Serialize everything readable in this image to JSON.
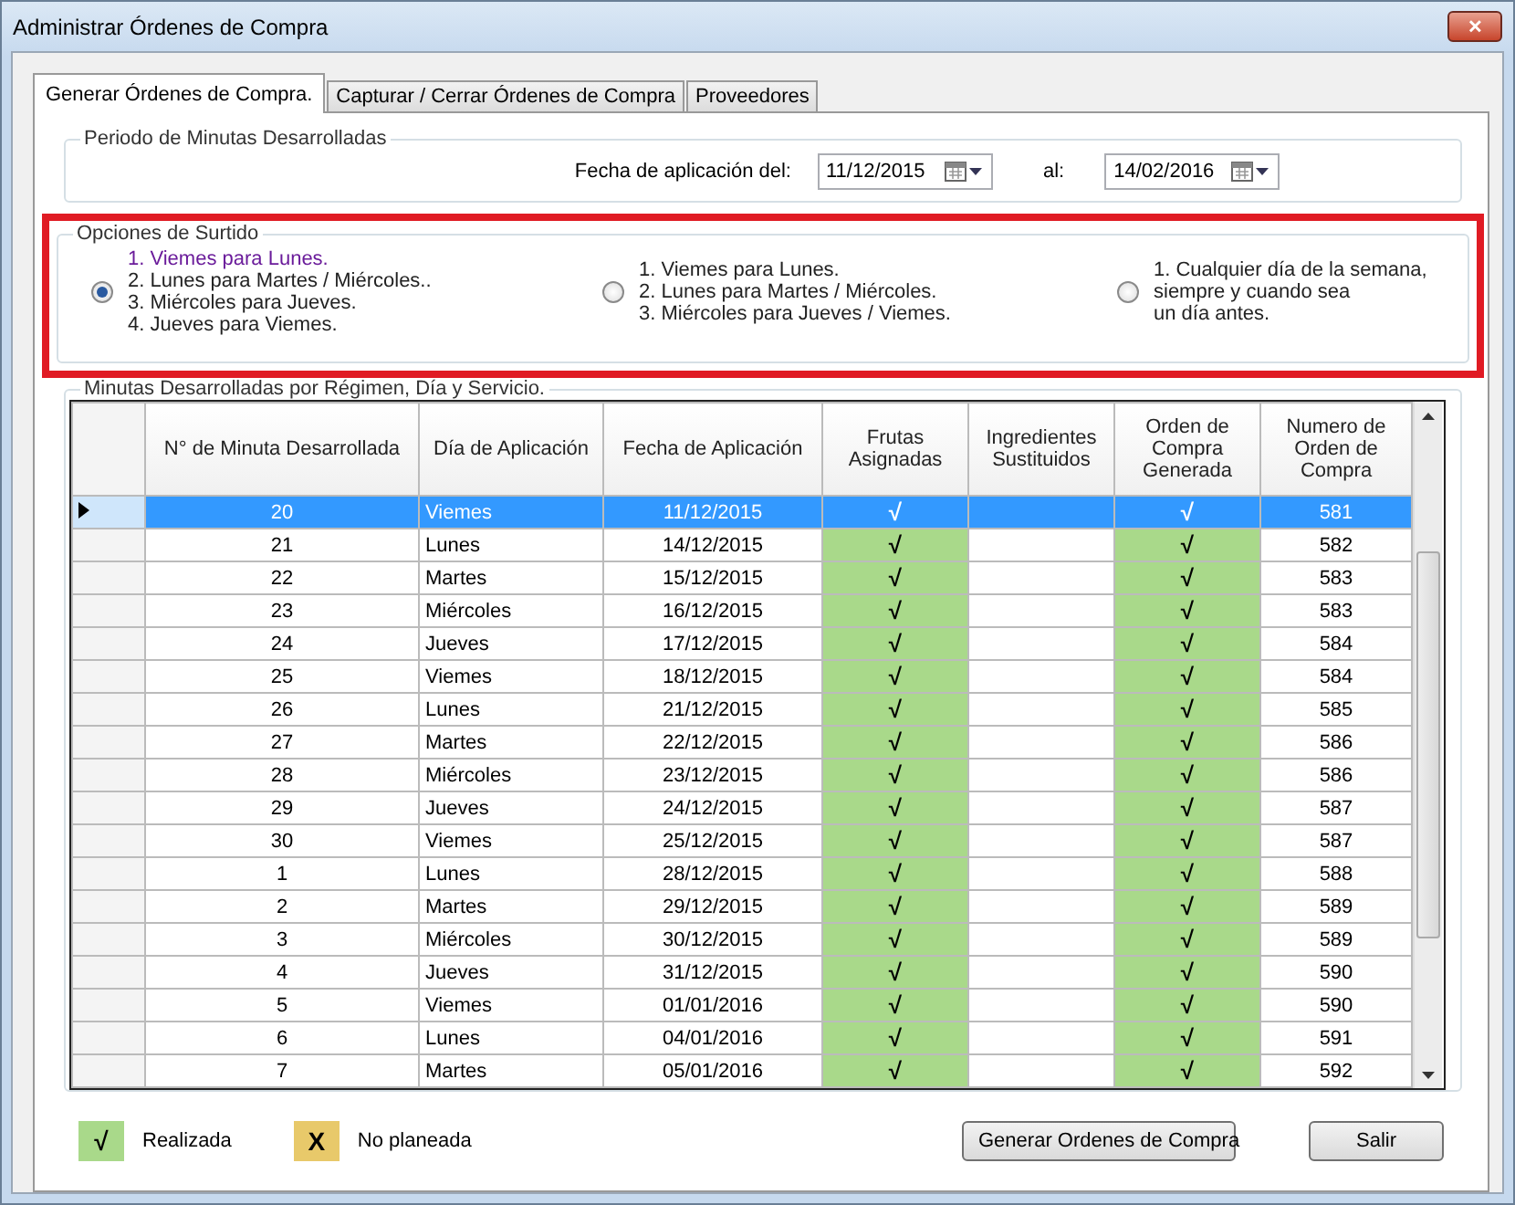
{
  "window": {
    "title": "Administrar Órdenes de Compra",
    "close": "✕"
  },
  "tabs": [
    {
      "label": "Generar Órdenes de Compra.",
      "selected": true
    },
    {
      "label": "Capturar / Cerrar Órdenes de Compra",
      "selected": false
    },
    {
      "label": "Proveedores",
      "selected": false
    }
  ],
  "periodo": {
    "title": "Periodo de Minutas Desarrolladas",
    "from_label": "Fecha de aplicación del:",
    "from_value": "11/12/2015",
    "to_label": "al:",
    "to_value": "14/02/2016"
  },
  "opciones": {
    "title": "Opciones de Surtido",
    "options": [
      {
        "lines": [
          "1. Viemes para Lunes.",
          "2. Lunes para Martes / Miércoles..",
          "3. Miércoles para Jueves.",
          "4. Jueves para Viemes."
        ],
        "selected": true
      },
      {
        "lines": [
          "1. Viemes para Lunes.",
          "2. Lunes para Martes / Miércoles.",
          "3. Miércoles para Jueves / Viemes."
        ],
        "selected": false
      },
      {
        "lines": [
          "1. Cualquier día de la semana,",
          "siempre y cuando sea",
          "un día antes."
        ],
        "selected": false
      }
    ]
  },
  "table": {
    "title": "Minutas Desarrolladas por Régimen, Día y Servicio.",
    "columns": [
      "N° de Minuta Desarrollada",
      "Día de Aplicación",
      "Fecha de Aplicación",
      "Frutas Asignadas",
      "Ingredientes Sustituidos",
      "Orden de Compra Generada",
      "Numero de Orden de Compra"
    ],
    "rows": [
      {
        "minuta": "20",
        "dia": "Viemes",
        "fecha": "11/12/2015",
        "frutas": "√",
        "frutas_done": true,
        "orden": "√",
        "orden_done": true,
        "numero": "581",
        "selected": true
      },
      {
        "minuta": "21",
        "dia": "Lunes",
        "fecha": "14/12/2015",
        "frutas": "√",
        "frutas_done": true,
        "orden": "√",
        "orden_done": true,
        "numero": "582",
        "selected": false
      },
      {
        "minuta": "22",
        "dia": "Martes",
        "fecha": "15/12/2015",
        "frutas": "√",
        "frutas_done": true,
        "orden": "√",
        "orden_done": true,
        "numero": "583",
        "selected": false
      },
      {
        "minuta": "23",
        "dia": "Miércoles",
        "fecha": "16/12/2015",
        "frutas": "√",
        "frutas_done": true,
        "orden": "√",
        "orden_done": true,
        "numero": "583",
        "selected": false
      },
      {
        "minuta": "24",
        "dia": "Jueves",
        "fecha": "17/12/2015",
        "frutas": "√",
        "frutas_done": true,
        "orden": "√",
        "orden_done": true,
        "numero": "584",
        "selected": false
      },
      {
        "minuta": "25",
        "dia": "Viemes",
        "fecha": "18/12/2015",
        "frutas": "√",
        "frutas_done": true,
        "orden": "√",
        "orden_done": true,
        "numero": "584",
        "selected": false
      },
      {
        "minuta": "26",
        "dia": "Lunes",
        "fecha": "21/12/2015",
        "frutas": "√",
        "frutas_done": true,
        "orden": "√",
        "orden_done": true,
        "numero": "585",
        "selected": false
      },
      {
        "minuta": "27",
        "dia": "Martes",
        "fecha": "22/12/2015",
        "frutas": "√",
        "frutas_done": true,
        "orden": "√",
        "orden_done": true,
        "numero": "586",
        "selected": false
      },
      {
        "minuta": "28",
        "dia": "Miércoles",
        "fecha": "23/12/2015",
        "frutas": "√",
        "frutas_done": true,
        "orden": "√",
        "orden_done": true,
        "numero": "586",
        "selected": false
      },
      {
        "minuta": "29",
        "dia": "Jueves",
        "fecha": "24/12/2015",
        "frutas": "√",
        "frutas_done": true,
        "orden": "√",
        "orden_done": true,
        "numero": "587",
        "selected": false
      },
      {
        "minuta": "30",
        "dia": "Viemes",
        "fecha": "25/12/2015",
        "frutas": "√",
        "frutas_done": true,
        "orden": "√",
        "orden_done": true,
        "numero": "587",
        "selected": false
      },
      {
        "minuta": "1",
        "dia": "Lunes",
        "fecha": "28/12/2015",
        "frutas": "√",
        "frutas_done": true,
        "orden": "√",
        "orden_done": true,
        "numero": "588",
        "selected": false
      },
      {
        "minuta": "2",
        "dia": "Martes",
        "fecha": "29/12/2015",
        "frutas": "√",
        "frutas_done": true,
        "orden": "√",
        "orden_done": true,
        "numero": "589",
        "selected": false
      },
      {
        "minuta": "3",
        "dia": "Miércoles",
        "fecha": "30/12/2015",
        "frutas": "√",
        "frutas_done": true,
        "orden": "√",
        "orden_done": true,
        "numero": "589",
        "selected": false
      },
      {
        "minuta": "4",
        "dia": "Jueves",
        "fecha": "31/12/2015",
        "frutas": "√",
        "frutas_done": true,
        "orden": "√",
        "orden_done": true,
        "numero": "590",
        "selected": false
      },
      {
        "minuta": "5",
        "dia": "Viemes",
        "fecha": "01/01/2016",
        "frutas": "√",
        "frutas_done": true,
        "orden": "√",
        "orden_done": true,
        "numero": "590",
        "selected": false
      },
      {
        "minuta": "6",
        "dia": "Lunes",
        "fecha": "04/01/2016",
        "frutas": "√",
        "frutas_done": true,
        "orden": "√",
        "orden_done": true,
        "numero": "591",
        "selected": false
      },
      {
        "minuta": "7",
        "dia": "Martes",
        "fecha": "05/01/2016",
        "frutas": "√",
        "frutas_done": true,
        "orden": "√",
        "orden_done": true,
        "numero": "592",
        "selected": false
      }
    ]
  },
  "legend": [
    {
      "symbol": "√",
      "label": "Realizada",
      "color": "#a9d98a"
    },
    {
      "symbol": "X",
      "label": "No planeada",
      "color": "#e8c96a"
    }
  ],
  "buttons": [
    "Generar Ordenes de Compra",
    "Salir"
  ]
}
